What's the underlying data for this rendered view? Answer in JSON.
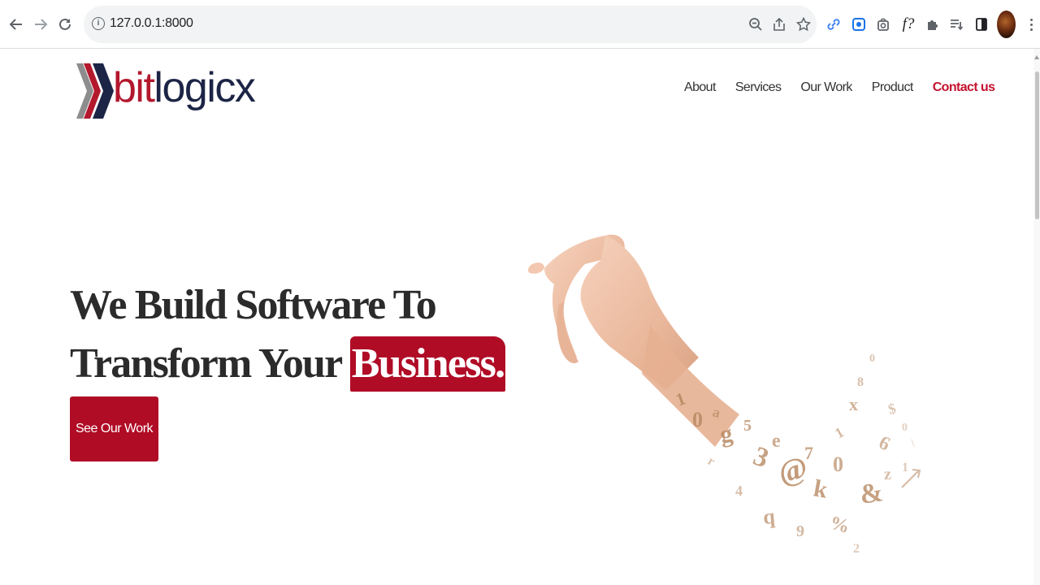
{
  "browser": {
    "url": "127.0.0.1:8000",
    "icons": {
      "back": "arrow-left-icon",
      "forward": "arrow-right-icon",
      "reload": "reload-icon",
      "site_info": "info-icon",
      "zoom": "zoom-icon",
      "share": "share-icon",
      "bookmark": "star-icon",
      "extensions": [
        "link-icon",
        "screen-capture-icon",
        "camera-icon",
        "function-icon",
        "puzzle-icon",
        "reading-list-icon",
        "side-panel-icon"
      ],
      "profile": "avatar",
      "menu": "more-vert-icon"
    },
    "extension_labels": {
      "function": "f?"
    }
  },
  "site": {
    "logo": {
      "prefix": "bit",
      "suffix": "logicx"
    },
    "nav": {
      "about": "About",
      "services": "Services",
      "our_work": "Our Work",
      "product": "Product",
      "contact": "Contact us"
    },
    "hero": {
      "line1": "We Build Software To",
      "line2": "Transform Your",
      "highlight": "Business.",
      "cta": "See Our Work"
    }
  },
  "colors": {
    "brand_red": "#b00c26",
    "brand_navy": "#1c2546",
    "contact_red": "#c4122f",
    "heading": "#2b2b2b"
  }
}
